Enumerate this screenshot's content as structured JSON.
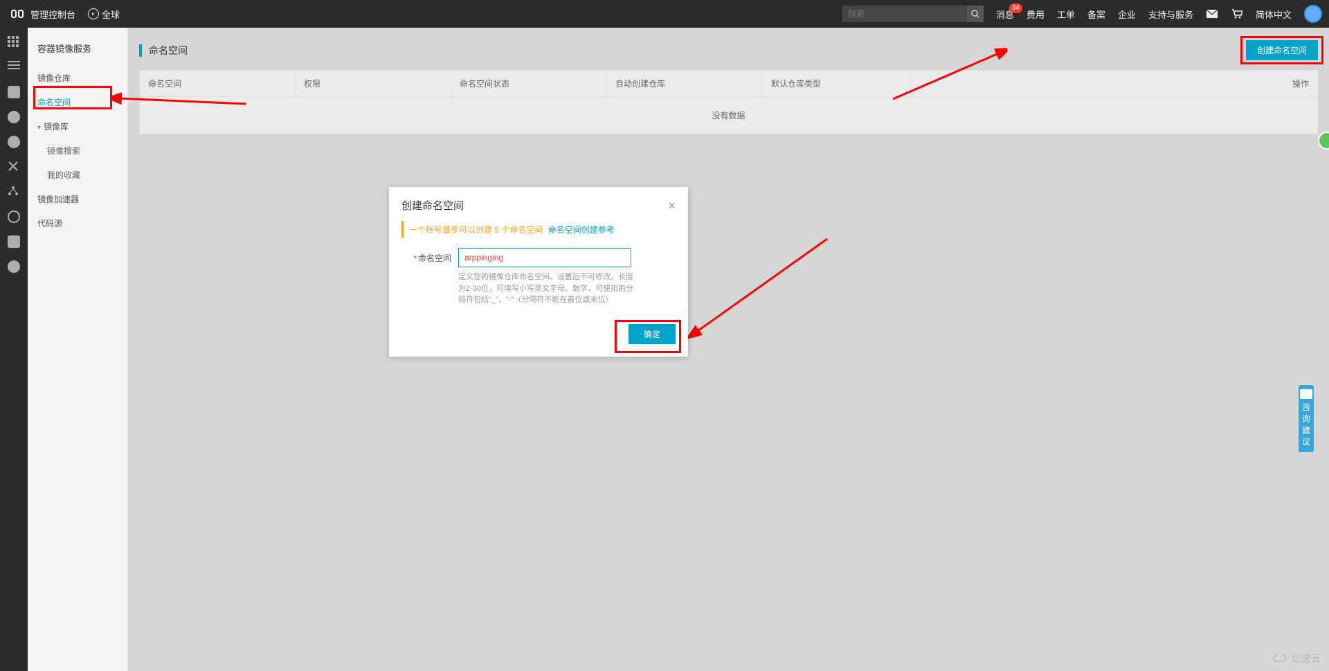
{
  "topbar": {
    "product": "管理控制台",
    "region": "全球",
    "search_placeholder": "搜索",
    "links": {
      "messages": "消息",
      "messages_badge": "34",
      "cost": "费用",
      "ticket": "工单",
      "beian": "备案",
      "enterprise": "企业",
      "support": "支持与服务",
      "lang": "简体中文"
    }
  },
  "sidebar": {
    "service": "容器镜像服务",
    "items": [
      {
        "label": "镜像仓库"
      },
      {
        "label": "命名空间"
      },
      {
        "label": "镜像库"
      },
      {
        "label": "镜像搜索"
      },
      {
        "label": "我的收藏"
      },
      {
        "label": "镜像加速器"
      },
      {
        "label": "代码源"
      }
    ]
  },
  "page": {
    "title": "命名空间",
    "create_button": "创建命名空间"
  },
  "table": {
    "cols": [
      "命名空间",
      "权限",
      "命名空间状态",
      "自动创建仓库",
      "默认仓库类型",
      "操作"
    ],
    "empty": "没有数据"
  },
  "modal": {
    "title": "创建命名空间",
    "note_prefix": "一个账号最多可以创建 5 个命名空间",
    "note_link": "命名空间创建参考",
    "field_label": "命名空间",
    "field_value": "arppinging",
    "hint": "定义您的镜像仓库命名空间，设置后不可修改。长度为2-30位，可填写小写英文字母、数字，可使用的分隔符包括\"_\"、\"-\"（分隔符不能在首位或末位）",
    "ok": "确定"
  },
  "consult": "咨询建议",
  "watermark": "亿速云"
}
